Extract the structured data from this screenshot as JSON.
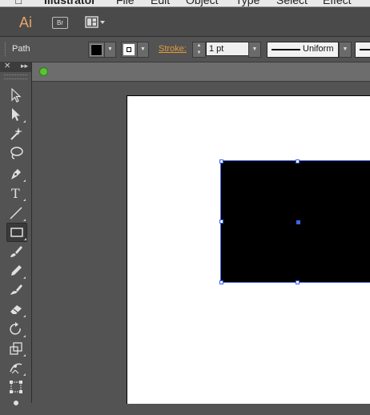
{
  "menubar": {
    "app_name": "Illustrator",
    "menus": [
      "File",
      "Edit",
      "Object",
      "Type",
      "Select",
      "Effect"
    ]
  },
  "appbar": {
    "logo": "Ai",
    "bridge_label": "Br",
    "workspace_icon": "arrange-documents-icon"
  },
  "control": {
    "selection_type": "Path",
    "fill_color": "#000000",
    "stroke_color": "#ffffff",
    "stroke_label": "Stroke:",
    "stroke_weight": "1 pt",
    "profile_label": "Uniform"
  },
  "tools": {
    "icons": [
      "selection-tool-icon",
      "direct-selection-tool-icon",
      "magic-wand-tool-icon",
      "lasso-tool-icon",
      "pen-tool-icon",
      "type-tool-icon",
      "line-segment-tool-icon",
      "rectangle-tool-icon",
      "paintbrush-tool-icon",
      "pencil-tool-icon",
      "blob-brush-tool-icon",
      "eraser-tool-icon",
      "rotate-tool-icon",
      "scale-tool-icon",
      "width-tool-icon",
      "free-transform-tool-icon"
    ],
    "active": "rectangle-tool-icon"
  },
  "colors": {
    "accent_orange": "#e39a3c",
    "selection_blue": "#3b63e8",
    "panel_bg": "#535353"
  }
}
